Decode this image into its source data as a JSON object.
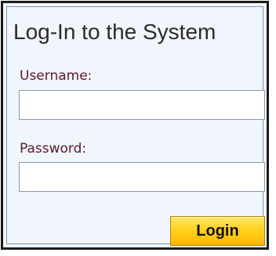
{
  "login_form": {
    "title": "Log-In to the System",
    "username_label": "Username:",
    "username_value": "",
    "password_label": "Password:",
    "password_value": "",
    "login_button_label": "Login"
  },
  "colors": {
    "panel_background": "#f1f6fd",
    "panel_border": "#1a1a1a",
    "label_text": "#5a1830",
    "button_yellow": "#ffd21f"
  }
}
